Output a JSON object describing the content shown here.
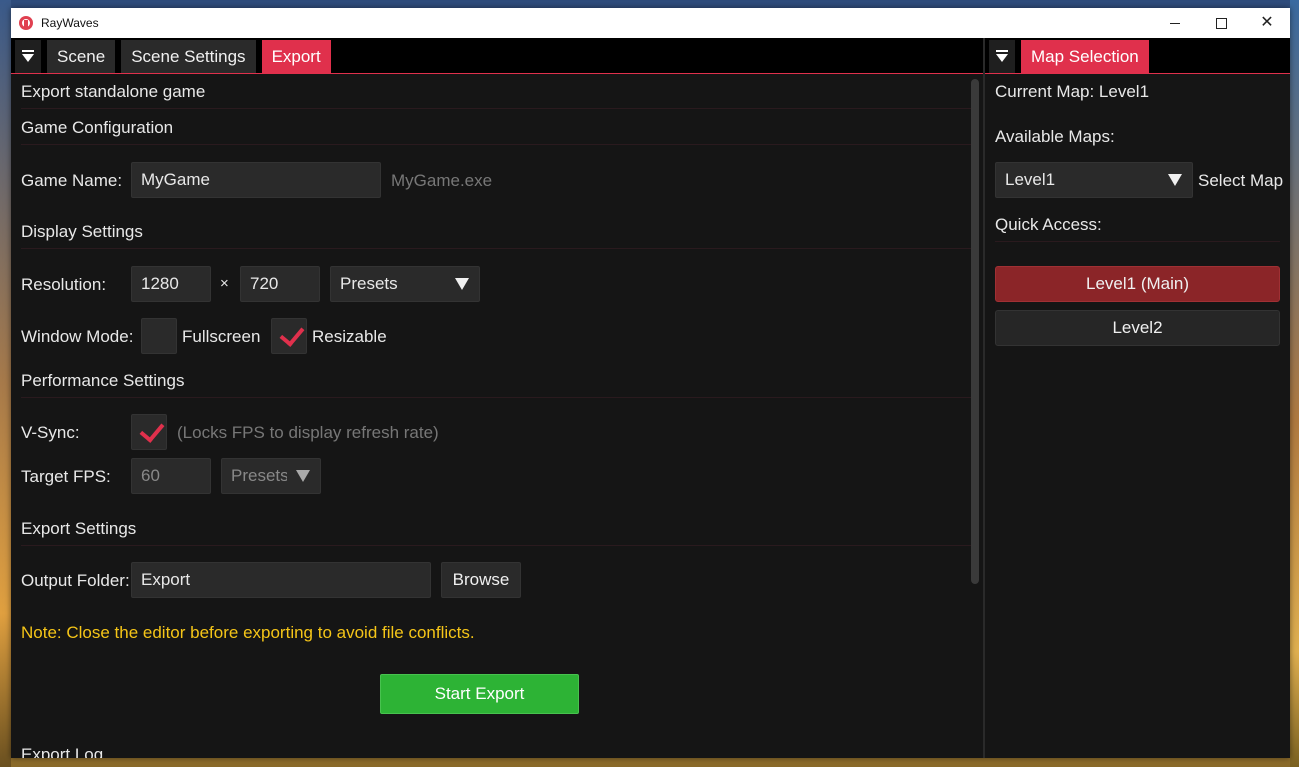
{
  "window": {
    "title": "RayWaves"
  },
  "left_panel": {
    "tabs": [
      {
        "label": "Scene",
        "active": false
      },
      {
        "label": "Scene Settings",
        "active": false
      },
      {
        "label": "Export",
        "active": true
      }
    ],
    "heading": "Export standalone game",
    "game_config": {
      "section": "Game Configuration",
      "game_name_label": "Game Name:",
      "game_name_value": "MyGame",
      "exe_hint": "MyGame.exe"
    },
    "display": {
      "section": "Display Settings",
      "resolution_label": "Resolution:",
      "width": "1280",
      "times": "×",
      "height": "720",
      "presets": "Presets",
      "window_mode_label": "Window Mode:",
      "fullscreen_label": "Fullscreen",
      "fullscreen_checked": false,
      "resizable_label": "Resizable",
      "resizable_checked": true
    },
    "performance": {
      "section": "Performance Settings",
      "vsync_label": "V-Sync:",
      "vsync_checked": true,
      "vsync_hint": "(Locks FPS to display refresh rate)",
      "fps_label": "Target FPS:",
      "fps_value": "60",
      "fps_presets": "Presets"
    },
    "export": {
      "section": "Export Settings",
      "output_label": "Output Folder:",
      "output_value": "Export",
      "browse_label": "Browse",
      "note": "Note: Close the editor before exporting to avoid file conflicts.",
      "start_label": "Start Export",
      "log_label": "Export Log"
    }
  },
  "right_panel": {
    "tab": "Map Selection",
    "current_map": "Current Map: Level1",
    "available_label": "Available Maps:",
    "selected_map": "Level1",
    "select_label": "Select Map",
    "quick_access_label": "Quick Access:",
    "quick_maps": [
      "Level1 (Main)",
      "Level2"
    ]
  },
  "colors": {
    "accent": "#e0304c",
    "export_button": "#2db335",
    "note": "#f5c518",
    "main_map": "#8b2528"
  }
}
